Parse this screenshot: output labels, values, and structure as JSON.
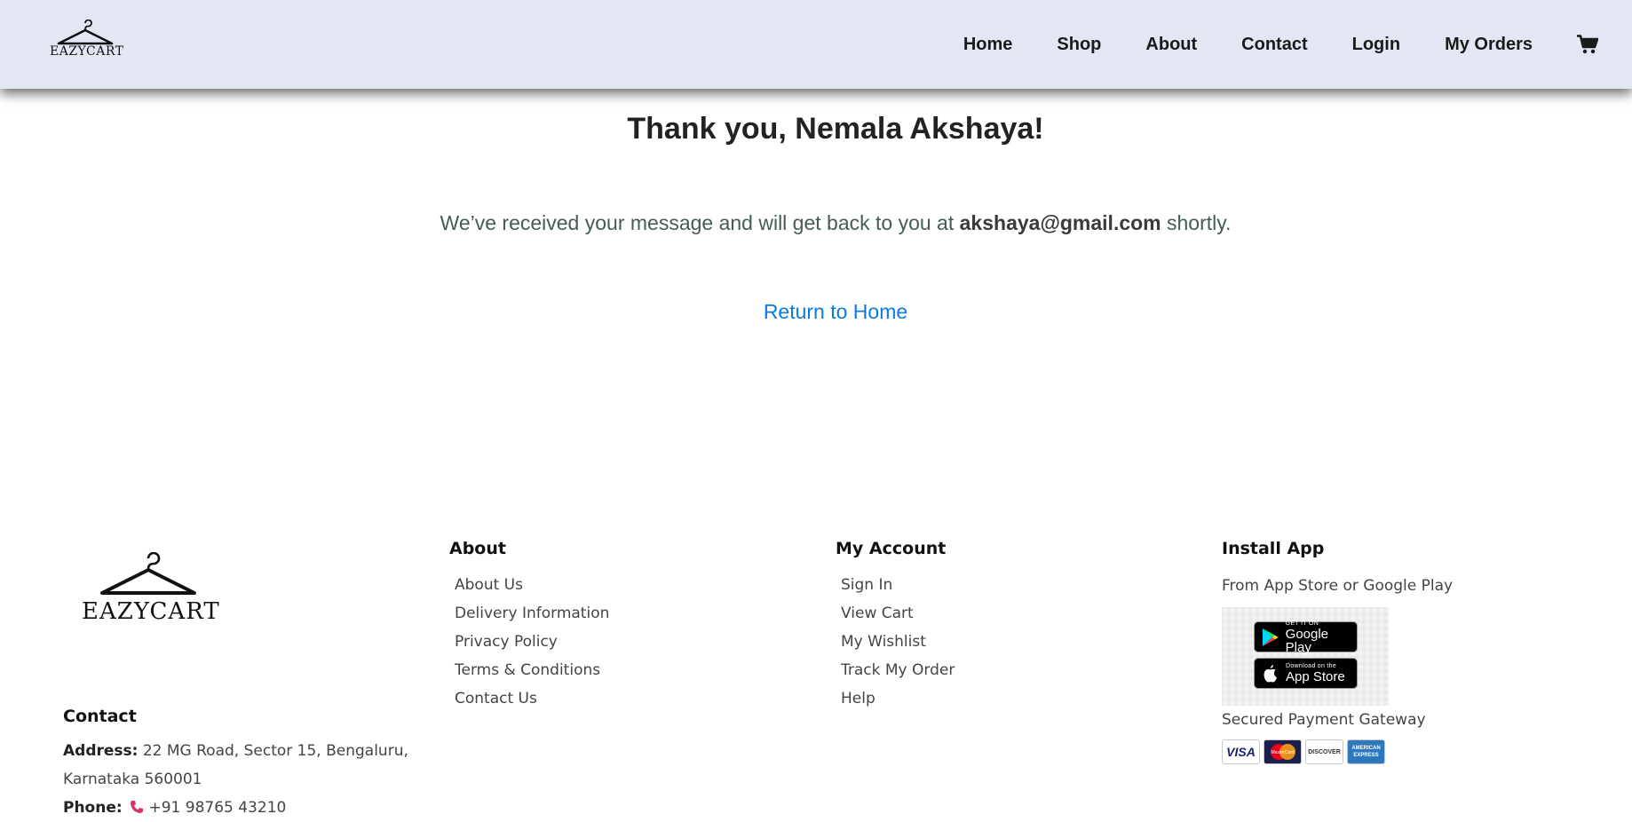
{
  "header": {
    "logo_text": "EAZYCART",
    "nav": [
      "Home",
      "Shop",
      "About",
      "Contact",
      "Login",
      "My Orders"
    ]
  },
  "main": {
    "title": "Thank you, Nemala Akshaya!",
    "message_prefix": "We’ve received your message and will get back to you at ",
    "message_email": "akshaya@gmail.com",
    "message_suffix": " shortly.",
    "return_link": "Return to Home"
  },
  "footer": {
    "logo_text": "EAZYCART",
    "contact": {
      "heading": "Contact",
      "address_label": "Address:",
      "address_value": " 22 MG Road, Sector 15, Bengaluru, Karnataka 560001",
      "phone_label": "Phone:",
      "phone_value": " +91 98765 43210"
    },
    "about": {
      "heading": "About",
      "links": [
        "About Us",
        "Delivery Information",
        "Privacy Policy",
        "Terms & Conditions",
        "Contact Us"
      ]
    },
    "account": {
      "heading": "My Account",
      "links": [
        "Sign In",
        "View Cart",
        "My Wishlist",
        "Track My Order",
        "Help"
      ]
    },
    "install": {
      "heading": "Install App",
      "subtitle": "From App Store or Google Play",
      "google_small": "GET IT ON",
      "google_big": "Google Play",
      "apple_small": "Download on the",
      "apple_big": "App Store",
      "payment_text": "Secured Payment Gateway",
      "cards": [
        "VISA",
        "MasterCard",
        "DISCOVER",
        "AMERICAN EXPRESS"
      ]
    }
  },
  "colors": {
    "header_bg": "#e3e6f3",
    "link_blue": "#0d7ae0",
    "text_gray": "#444444"
  }
}
